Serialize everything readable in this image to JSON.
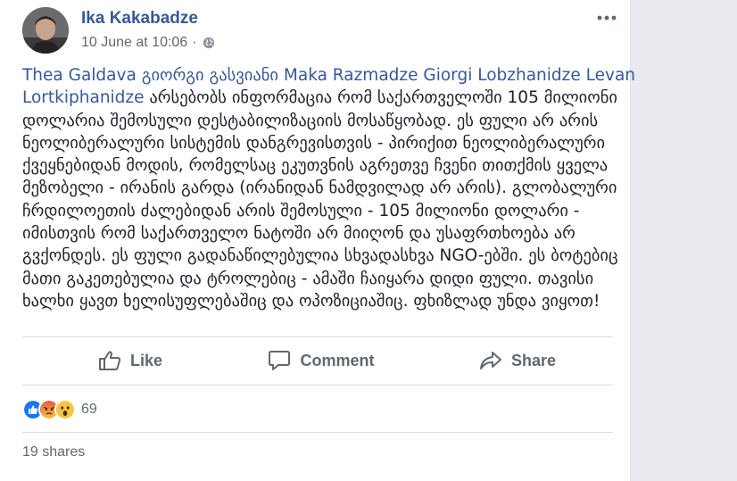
{
  "post": {
    "author": "Ika Kakabadze",
    "date": "10 June at 10:06",
    "separator": "·",
    "privacy_icon": "globe-icon",
    "lines": [
      [
        {
          "text": "Thea Galdava",
          "tag": true
        },
        {
          "text": " ",
          "tag": false
        },
        {
          "text": "გიორგი გასვიანი",
          "tag": true
        },
        {
          "text": " ",
          "tag": false
        },
        {
          "text": "Maka Razmadze",
          "tag": true
        },
        {
          "text": " ",
          "tag": false
        },
        {
          "text": "Giorgi Lobzhanidze",
          "tag": true
        },
        {
          "text": " ",
          "tag": false
        },
        {
          "text": "Levan",
          "tag": true
        }
      ],
      [
        {
          "text": "Lortkiphanidze",
          "tag": true
        },
        {
          "text": " არსებობს ინფორმაცია რომ საქართველოში 105 მილიონი",
          "tag": false
        }
      ],
      [
        {
          "text": "დოლარია შემოსული დესტაბილიზაციის მოსაწყობად. ეს ფული არ არის",
          "tag": false
        }
      ],
      [
        {
          "text": "ნეოლიბერალური სისტემის დანგრევისთვის - პირიქით ნეოლიბერალური",
          "tag": false
        }
      ],
      [
        {
          "text": "ქვეყნებიდან მოდის, რომელსაც ეკუთვნის აგრეთვე ჩვენი თითქმის ყველა",
          "tag": false
        }
      ],
      [
        {
          "text": "მეზობელი - ირანის გარდა (ირანიდან ნამდვილად არ არის). გლობალური",
          "tag": false
        }
      ],
      [
        {
          "text": "ჩრდილოეთის ძალებიდან არის შემოსული - 105 მილიონი დოლარი -",
          "tag": false
        }
      ],
      [
        {
          "text": "იმისთვის რომ საქართველო ნატოში არ მიიღონ და უსაფრთხოება არ",
          "tag": false
        }
      ],
      [
        {
          "text": "გვქონდეს. ეს ფული გადანაწილებულია სხვადასხვა NGO-ებში. ეს ბოტებიც",
          "tag": false
        }
      ],
      [
        {
          "text": "მათი გაკეთებულია და ტროლებიც - ამაში ჩაიყარა დიდი ფული. თავისი",
          "tag": false
        }
      ],
      [
        {
          "text": "ხალხი ყავთ ხელისუფლებაშიც და ოპოზიციაშიც. ფხიზლად უნდა ვიყოთ!",
          "tag": false
        }
      ]
    ]
  },
  "actions": {
    "like": {
      "label": "Like",
      "icon": "thumbs-up-icon"
    },
    "comment": {
      "label": "Comment",
      "icon": "comment-icon"
    },
    "share": {
      "label": "Share",
      "icon": "share-icon"
    }
  },
  "reactions": {
    "icons": [
      "like-reaction-icon",
      "angry-reaction-icon",
      "wow-reaction-icon"
    ],
    "count": "69"
  },
  "shares": "19 shares",
  "colors": {
    "link": "#385898",
    "text": "#1d2129",
    "muted": "#616770",
    "background": "#e9ebee"
  }
}
